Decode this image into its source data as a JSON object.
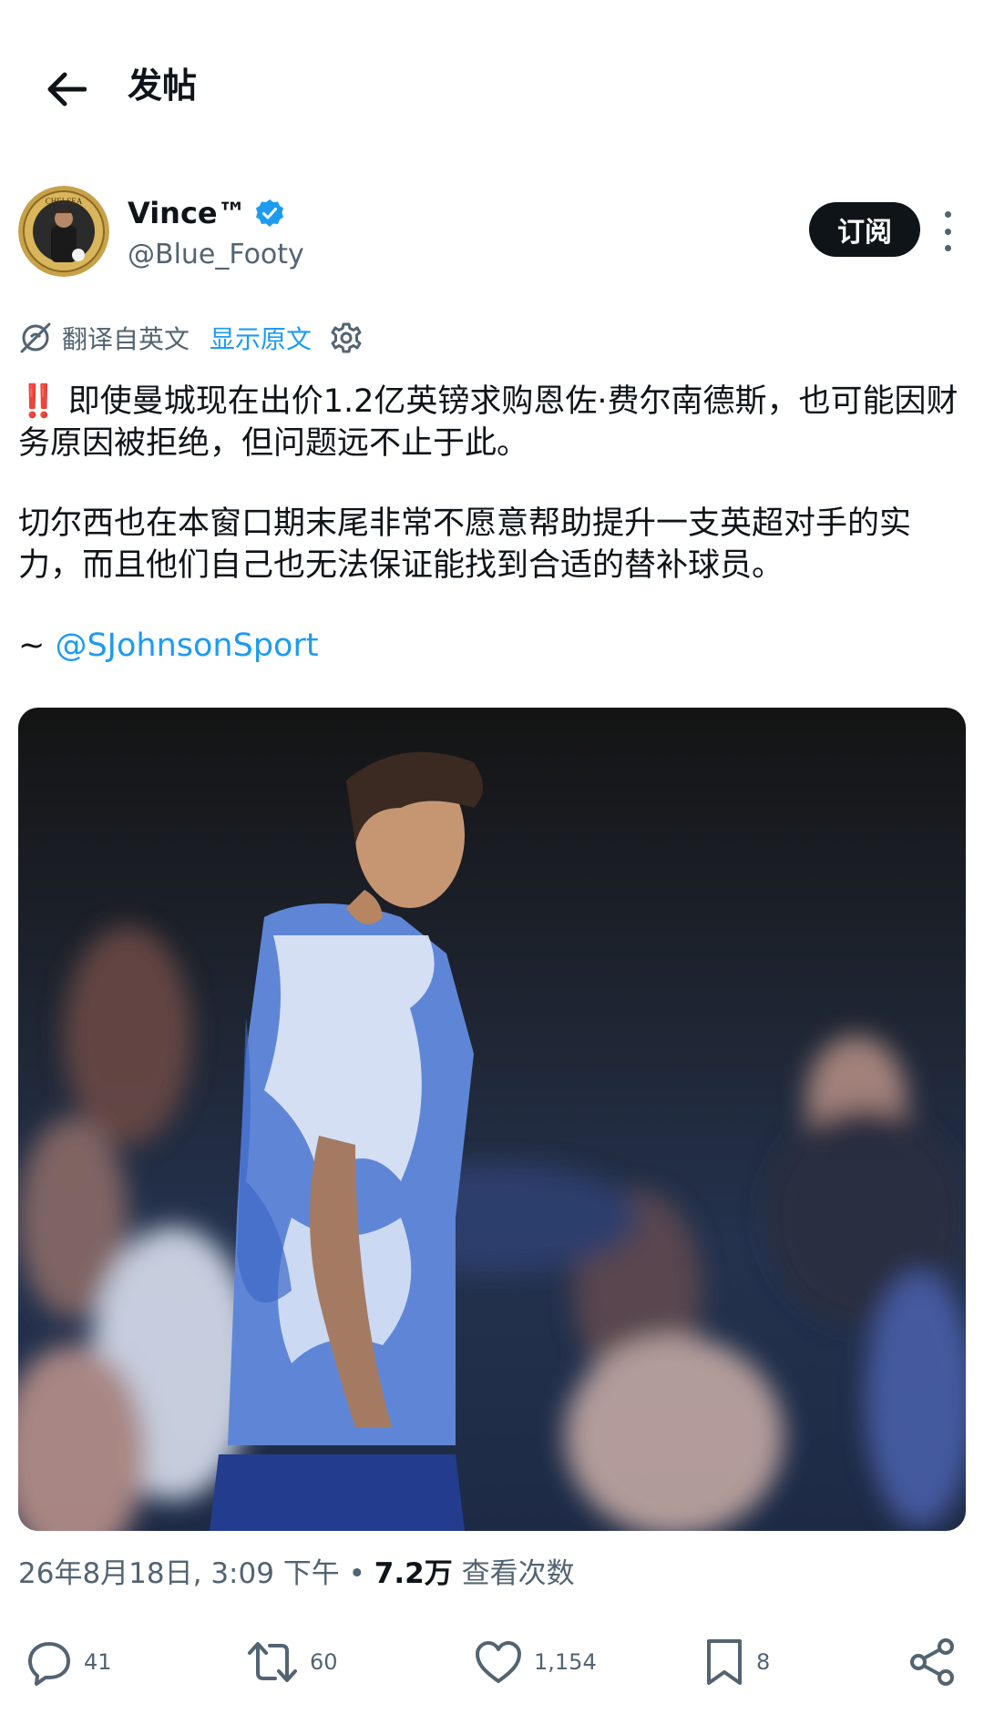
{
  "header": {
    "title": "发帖",
    "back_icon": "arrow-left-icon"
  },
  "author": {
    "display_name": "Vince™",
    "handle": "@Blue_Footy",
    "verified": true,
    "avatar_text": "CHELSEA",
    "subscribe_label": "订阅"
  },
  "translation": {
    "notice": "翻译自英文",
    "show_original": "显示原文"
  },
  "post": {
    "alert_emoji": "‼️",
    "paragraph1": "即使曼城现在出价1.2亿英镑求购恩佐·费尔南德斯，也可能因财务原因被拒绝，但问题远不止于此。",
    "paragraph2": "切尔西也在本窗口期末尾非常不愿意帮助提升一支英超对手的实力，而且他们自己也无法保证能找到合适的替补球员。",
    "credit_prefix": "~ ",
    "credit_mention": "@SJohnsonSport"
  },
  "meta": {
    "timestamp": "26年8月18日, 3:09 下午",
    "separator": " • ",
    "views_count": "7.2万",
    "views_label": " 查看次数"
  },
  "actions": {
    "replies": "41",
    "reposts": "60",
    "likes": "1,154",
    "bookmarks": "8"
  },
  "colors": {
    "accent": "#1d9bf0",
    "text": "#0f1419",
    "muted": "#536471"
  }
}
